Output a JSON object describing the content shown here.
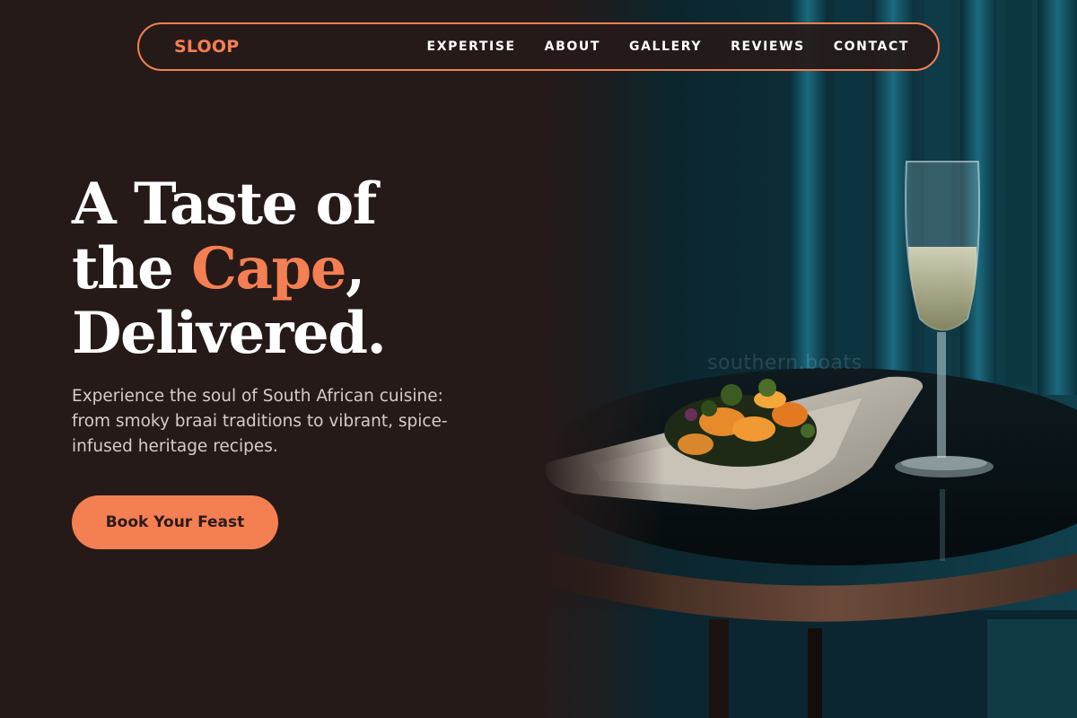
{
  "brand": {
    "name": "SLOOP",
    "accent_color": "#f47f52",
    "background_color": "#261a19"
  },
  "nav": {
    "items": [
      {
        "label": "EXPERTISE"
      },
      {
        "label": "ABOUT"
      },
      {
        "label": "GALLERY"
      },
      {
        "label": "REVIEWS"
      },
      {
        "label": "CONTACT"
      }
    ]
  },
  "hero": {
    "title_line1": "A Taste of",
    "title_line2_pre": "the ",
    "title_line2_accent": "Cape",
    "title_line2_post": ",",
    "title_line3": "Delivered.",
    "subtitle": "Experience the soul of South African cuisine: from smoky braai traditions to vibrant, spice-infused heritage recipes.",
    "cta_label": "Book Your Feast"
  },
  "image": {
    "watermark": "southern.boats"
  }
}
